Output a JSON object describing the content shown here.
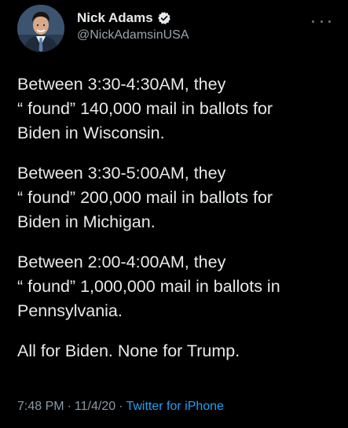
{
  "author": {
    "display_name": "Nick Adams",
    "handle": "@NickAdamsinUSA",
    "verified": true,
    "avatar_icon": "profile-photo-avatar"
  },
  "tweet": {
    "paragraphs": [
      "Between 3:30-4:30AM, they\n“ found” 140,000 mail in ballots for\nBiden in Wisconsin.",
      "Between 3:30-5:00AM, they\n“ found” 200,000 mail in ballots for\nBiden in Michigan.",
      "Between 2:00-4:00AM, they\n“ found” 1,000,000 mail in ballots in\nPennsylvania.",
      "All for Biden. None for Trump."
    ]
  },
  "meta": {
    "time": "7:48 PM",
    "separator": "·",
    "date": "11/4/20",
    "source": "Twitter for iPhone"
  },
  "colors": {
    "background": "#000000",
    "text": "#e7e9ea",
    "secondary": "#8b98a5",
    "link": "#1da1f2",
    "verified": "#1da1f2"
  },
  "icons": {
    "more": "more-options-icon",
    "verified": "verified-badge-icon"
  }
}
